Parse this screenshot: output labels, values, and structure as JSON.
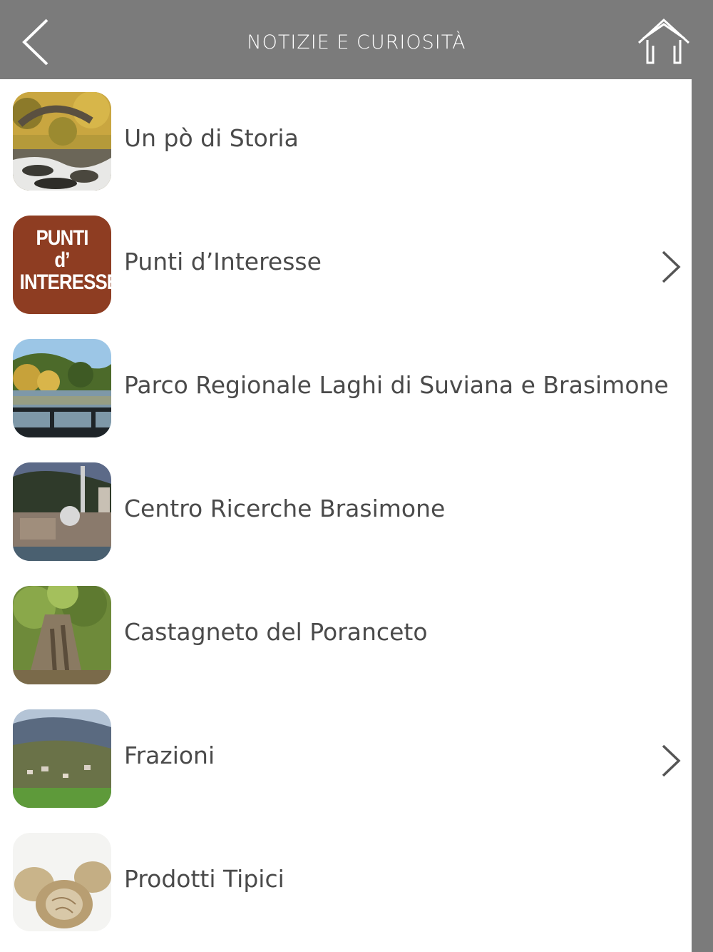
{
  "header": {
    "title": "NOTIZIE E CURIOSITÀ",
    "back_icon": "chevron-left-icon",
    "home_icon": "home-icon"
  },
  "items": [
    {
      "label": "Un pò di Storia",
      "has_chevron": false
    },
    {
      "label": "Punti d’Interesse",
      "has_chevron": true,
      "thumb_text": [
        "PUNTI",
        "d’",
        "INTERESSE"
      ]
    },
    {
      "label": "Parco Regionale Laghi di Suviana e Brasimone",
      "has_chevron": false
    },
    {
      "label": "Centro Ricerche Brasimone",
      "has_chevron": false
    },
    {
      "label": "Castagneto del Poranceto",
      "has_chevron": false
    },
    {
      "label": "Frazioni",
      "has_chevron": true
    },
    {
      "label": "Prodotti Tipici",
      "has_chevron": false
    }
  ],
  "colors": {
    "header_bg": "#7b7b7b",
    "list_bg": "#ffffff",
    "text": "#4a4a4a",
    "punti_badge": "#8e3d22"
  }
}
